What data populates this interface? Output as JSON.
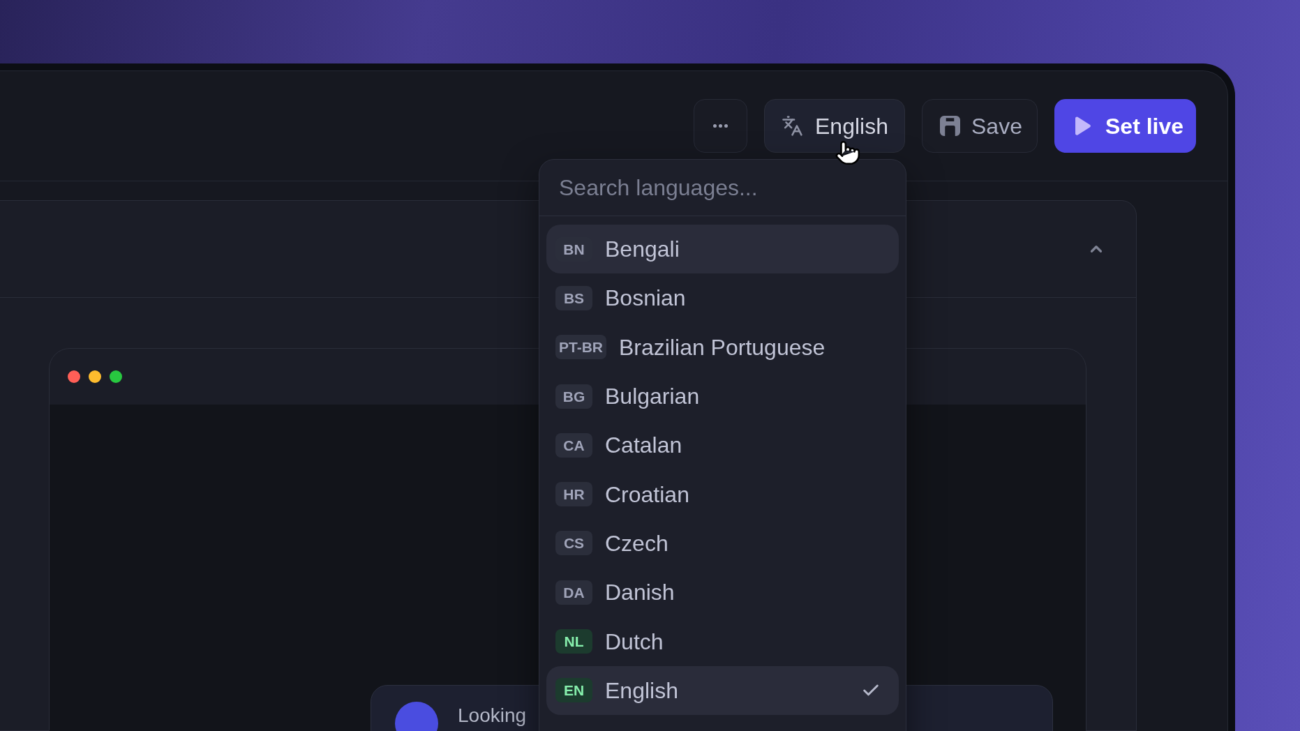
{
  "toolbar": {
    "language_button": {
      "label": "English"
    },
    "save_button": {
      "label": "Save"
    },
    "publish_button": {
      "label": "Set live"
    }
  },
  "language_menu": {
    "search": {
      "placeholder": "Search languages..."
    },
    "languages": [
      {
        "code": "BN",
        "name": "Bengali",
        "translated": false,
        "focused": true,
        "selected": false
      },
      {
        "code": "BS",
        "name": "Bosnian",
        "translated": false,
        "focused": false,
        "selected": false
      },
      {
        "code": "PT-BR",
        "name": "Brazilian Portuguese",
        "translated": false,
        "focused": false,
        "selected": false
      },
      {
        "code": "BG",
        "name": "Bulgarian",
        "translated": false,
        "focused": false,
        "selected": false
      },
      {
        "code": "CA",
        "name": "Catalan",
        "translated": false,
        "focused": false,
        "selected": false
      },
      {
        "code": "HR",
        "name": "Croatian",
        "translated": false,
        "focused": false,
        "selected": false
      },
      {
        "code": "CS",
        "name": "Czech",
        "translated": false,
        "focused": false,
        "selected": false
      },
      {
        "code": "DA",
        "name": "Danish",
        "translated": false,
        "focused": false,
        "selected": false
      },
      {
        "code": "NL",
        "name": "Dutch",
        "translated": true,
        "focused": false,
        "selected": false
      },
      {
        "code": "EN",
        "name": "English",
        "translated": true,
        "focused": false,
        "selected": true
      }
    ]
  },
  "preview": {
    "message": {
      "text": "Looking"
    }
  }
}
